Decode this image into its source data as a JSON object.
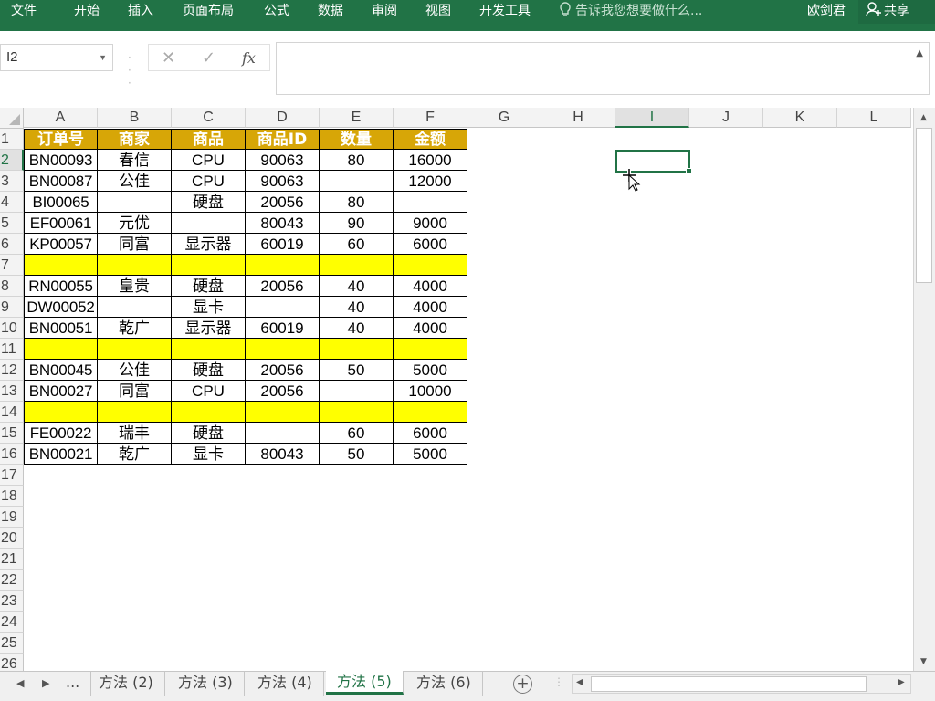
{
  "ribbon": {
    "tabs": [
      "文件",
      "开始",
      "插入",
      "页面布局",
      "公式",
      "数据",
      "审阅",
      "视图",
      "开发工具"
    ],
    "tell_me": "告诉我您想要做什么...",
    "user": "欧剑君",
    "share": "共享",
    "accent": "#217346"
  },
  "formula_bar": {
    "name_box": "I2",
    "fx": "fx",
    "value": ""
  },
  "columns": [
    "A",
    "B",
    "C",
    "D",
    "E",
    "F",
    "G",
    "H",
    "I",
    "J",
    "K",
    "L"
  ],
  "selected_column": "I",
  "selected_row": 2,
  "rows": [
    "1",
    "2",
    "3",
    "4",
    "5",
    "6",
    "7",
    "8",
    "9",
    "10",
    "11",
    "12",
    "13",
    "14",
    "15",
    "16",
    "17",
    "18",
    "19",
    "20",
    "21",
    "22",
    "23",
    "24",
    "25",
    "26"
  ],
  "table": {
    "header": [
      "订单号",
      "商家",
      "商品",
      "商品ID",
      "数量",
      "金额"
    ],
    "header_color": "#d7a607",
    "blank_row_color": "#ffff00",
    "rows": [
      [
        "BN00093",
        "春信",
        "CPU",
        "90063",
        "80",
        "16000"
      ],
      [
        "BN00087",
        "公佳",
        "CPU",
        "90063",
        "",
        "12000"
      ],
      [
        "BI00065",
        "",
        "硬盘",
        "20056",
        "80",
        ""
      ],
      [
        "EF00061",
        "元优",
        "",
        "80043",
        "90",
        "9000"
      ],
      [
        "KP00057",
        "同富",
        "显示器",
        "60019",
        "60",
        "6000"
      ],
      [
        "",
        "",
        "",
        "",
        "",
        ""
      ],
      [
        "RN00055",
        "皇贵",
        "硬盘",
        "20056",
        "40",
        "4000"
      ],
      [
        "DW00052",
        "",
        "显卡",
        "",
        "40",
        "4000"
      ],
      [
        "BN00051",
        "乾广",
        "显示器",
        "60019",
        "40",
        "4000"
      ],
      [
        "",
        "",
        "",
        "",
        "",
        ""
      ],
      [
        "BN00045",
        "公佳",
        "硬盘",
        "20056",
        "50",
        "5000"
      ],
      [
        "BN00027",
        "同富",
        "CPU",
        "20056",
        "",
        "10000"
      ],
      [
        "",
        "",
        "",
        "",
        "",
        ""
      ],
      [
        "FE00022",
        "瑞丰",
        "硬盘",
        "",
        "60",
        "6000"
      ],
      [
        "BN00021",
        "乾广",
        "显卡",
        "80043",
        "50",
        "5000"
      ]
    ]
  },
  "sheet_tabs": {
    "more": "...",
    "tabs": [
      "方法 (2)",
      "方法 (3)",
      "方法 (4)",
      "方法 (5)",
      "方法 (6)"
    ],
    "active": "方法 (5)",
    "add": "+"
  }
}
